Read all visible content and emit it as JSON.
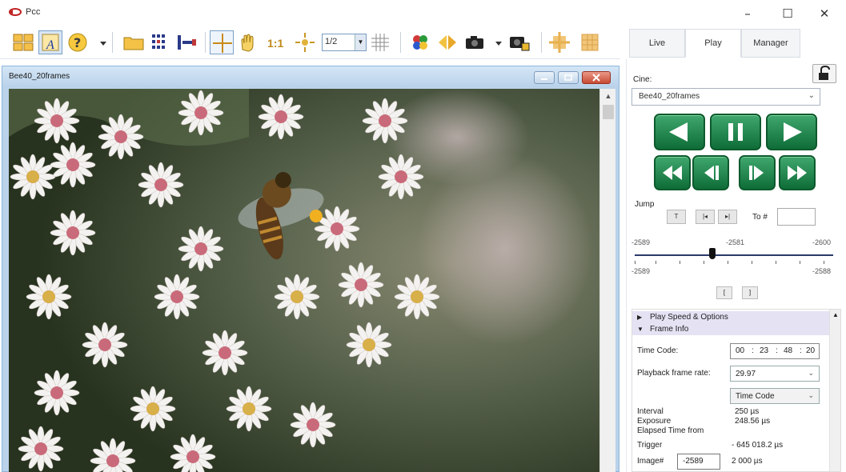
{
  "window": {
    "title": "Pcc",
    "controls": {
      "minimize": "–",
      "maximize": "☐",
      "close": "✕"
    }
  },
  "toolbar": {
    "zoom_value": "1/2",
    "icons": [
      "tile-windows-icon",
      "annotate-icon",
      "help-icon",
      "dropdown-arrow-icon",
      "open-folder-icon",
      "cine-list-icon",
      "segment-icon",
      "crosshair-icon",
      "pan-hand-icon",
      "actual-size-icon",
      "fit-window-icon",
      "grid-icon",
      "color-icon",
      "flip-icon",
      "camera-icon",
      "capture-icon",
      "brightness-icon",
      "overlay-icon"
    ]
  },
  "tabs": [
    {
      "label": "Live"
    },
    {
      "label": "Play"
    },
    {
      "label": "Manager"
    }
  ],
  "image_window": {
    "title": "Bee40_20frames"
  },
  "panel": {
    "cine_label": "Cine:",
    "cine_value": "Bee40_20frames",
    "jump_label": "Jump",
    "jump_buttons": [
      "T",
      "|◂",
      "▸|"
    ],
    "to_label": "To #",
    "to_value": "",
    "slider": {
      "top_left": "-2589",
      "top_mid": "-2581",
      "top_right": "-2600",
      "bottom_left": "-2589",
      "bottom_right": "-2588",
      "position": 0.39
    },
    "segment_buttons": [
      "[",
      "]"
    ],
    "sections": {
      "play_speed": "Play Speed & Options",
      "frame_info": "Frame Info"
    },
    "frame_info": {
      "time_code_label": "Time Code:",
      "time_code": {
        "hh": "00",
        "mm": "23",
        "ss": "48",
        "ff": "20"
      },
      "playback_rate_label": "Playback frame rate:",
      "playback_rate": "29.97",
      "time_format": "Time Code",
      "interval_label": "Interval",
      "interval_value": "250 µs",
      "exposure_label": "Exposure",
      "exposure_value": "248.56 µs",
      "elapsed_label": "Elapsed Time from",
      "trigger_label": "Trigger",
      "trigger_value": "- 645 018.2 µs",
      "image_label": "Image#",
      "image_value": "-2589",
      "image_time": "2 000 µs"
    }
  },
  "colors": {
    "green_button": "#1b8a4b",
    "caption": "#c7dcf0",
    "section": "#e4e2f3"
  }
}
